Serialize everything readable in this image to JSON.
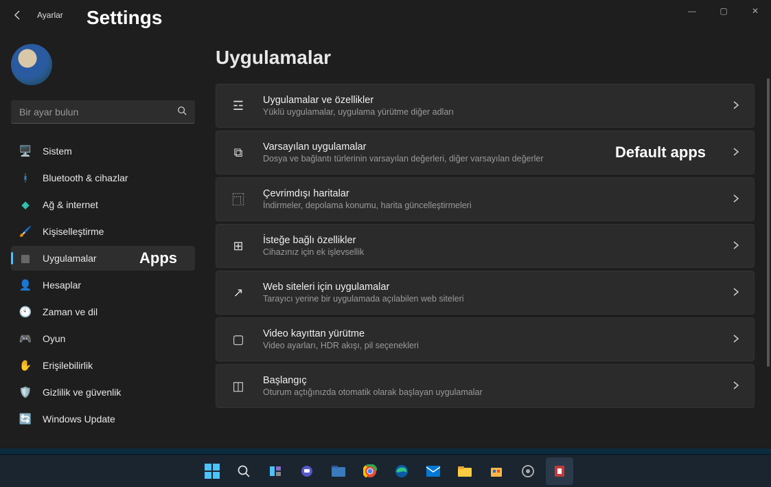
{
  "window": {
    "app_name": "Ayarlar",
    "overlay_title": "Settings"
  },
  "search": {
    "placeholder": "Bir ayar bulun"
  },
  "sidebar": {
    "items": [
      {
        "icon": "🖥️",
        "label": "Sistem",
        "annotation": "",
        "selected": false,
        "color": "#4cc2ff"
      },
      {
        "icon": "ᚼ",
        "label": "Bluetooth & cihazlar",
        "annotation": "",
        "selected": false,
        "color": "#4cc2ff"
      },
      {
        "icon": "◆",
        "label": "Ağ & internet",
        "annotation": "",
        "selected": false,
        "color": "#30c0b0"
      },
      {
        "icon": "🖌️",
        "label": "Kişiselleştirme",
        "annotation": "",
        "selected": false,
        "color": ""
      },
      {
        "icon": "▦",
        "label": "Uygulamalar",
        "annotation": "Apps",
        "selected": true,
        "color": "#888"
      },
      {
        "icon": "👤",
        "label": "Hesaplar",
        "annotation": "",
        "selected": false,
        "color": "#50c070"
      },
      {
        "icon": "🕙",
        "label": "Zaman ve dil",
        "annotation": "",
        "selected": false,
        "color": "#4cc2ff"
      },
      {
        "icon": "🎮",
        "label": "Oyun",
        "annotation": "",
        "selected": false,
        "color": "#aaa"
      },
      {
        "icon": "✋",
        "label": "Erişilebilirlik",
        "annotation": "",
        "selected": false,
        "color": "#4cc2ff"
      },
      {
        "icon": "🛡️",
        "label": "Gizlilik ve güvenlik",
        "annotation": "",
        "selected": false,
        "color": "#888"
      },
      {
        "icon": "🔄",
        "label": "Windows Update",
        "annotation": "",
        "selected": false,
        "color": "#4cc2ff"
      }
    ]
  },
  "main": {
    "title": "Uygulamalar",
    "cards": [
      {
        "name": "apps-features",
        "icon": "☲",
        "title": "Uygulamalar ve özellikler",
        "desc": "Yüklü uygulamalar, uygulama yürütme diğer adları",
        "annotation": ""
      },
      {
        "name": "default-apps",
        "icon": "⧉",
        "title": "Varsayılan uygulamalar",
        "desc": "Dosya ve bağlantı türlerinin varsayılan değerleri, diğer varsayılan değerler",
        "annotation": "Default apps"
      },
      {
        "name": "offline-maps",
        "icon": "⿹",
        "title": "Çevrimdışı haritalar",
        "desc": "İndirmeler, depolama konumu, harita güncelleştirmeleri",
        "annotation": ""
      },
      {
        "name": "optional-features",
        "icon": "⊞",
        "title": "İsteğe bağlı özellikler",
        "desc": "Cihazınız için ek işlevsellik",
        "annotation": ""
      },
      {
        "name": "apps-for-websites",
        "icon": "↗",
        "title": "Web siteleri için uygulamalar",
        "desc": "Tarayıcı yerine bir uygulamada açılabilen web siteleri",
        "annotation": ""
      },
      {
        "name": "video-playback",
        "icon": "▢",
        "title": "Video kayıttan yürütme",
        "desc": "Video ayarları, HDR akışı, pil seçenekleri",
        "annotation": ""
      },
      {
        "name": "startup",
        "icon": "◫",
        "title": "Başlangıç",
        "desc": "Oturum açtığınızda otomatik olarak başlayan uygulamalar",
        "annotation": ""
      }
    ]
  },
  "controls": {
    "min": "—",
    "max": "▢",
    "close": "✕"
  }
}
